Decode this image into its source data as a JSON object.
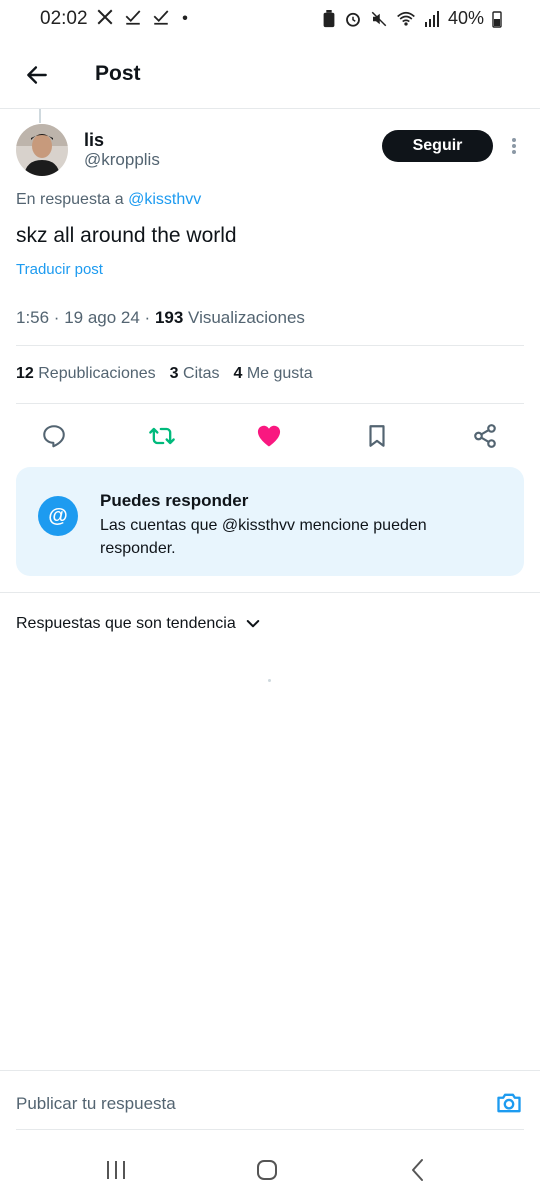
{
  "status_bar": {
    "time": "02:02",
    "battery": "40%",
    "icons": [
      "x-logo-icon",
      "check-icon",
      "check-icon",
      "dot-icon",
      "battery-saver-icon",
      "alarm-icon",
      "mute-icon",
      "wifi-icon",
      "signal-icon",
      "battery-icon"
    ]
  },
  "header": {
    "title": "Post",
    "back_icon": "arrow-left-icon"
  },
  "post": {
    "display_name": "lis",
    "handle": "@kropplis",
    "follow_label": "Seguir",
    "reply_prefix": "En respuesta a",
    "reply_to": "@kissthvv",
    "text": "skz all around the world",
    "translate_label": "Traducir post",
    "timestamp": "1:56 · 19 ago 24 · ",
    "views_count": "193",
    "views_label": "Visualizaciones"
  },
  "stats": {
    "reposts_count": "12",
    "reposts_label": "Republicaciones",
    "quotes_count": "3",
    "quotes_label": "Citas",
    "likes_count": "4",
    "likes_label": "Me gusta"
  },
  "actions": [
    "reply-icon",
    "repost-icon",
    "like-icon",
    "bookmark-icon",
    "share-icon"
  ],
  "colors": {
    "accent": "#1d9bf0",
    "repost_active": "#00ba7c",
    "like_active": "#f91880",
    "card_bg": "#e8f5fd",
    "follow_bg": "#0f1419"
  },
  "info_card": {
    "icon_glyph": "@",
    "title": "Puedes responder",
    "text": "Las cuentas que @kissthvv mencione pueden responder."
  },
  "trending": {
    "label": "Respuestas que son tendencia"
  },
  "composer": {
    "placeholder": "Publicar tu respuesta"
  },
  "nav": [
    "recent-apps-icon",
    "home-icon",
    "back-icon"
  ]
}
